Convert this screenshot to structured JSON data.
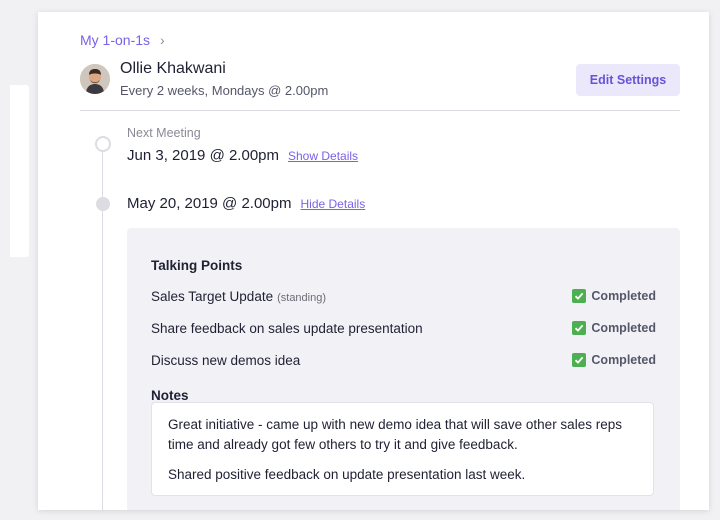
{
  "breadcrumb": {
    "label": "My 1-on-1s",
    "chevron": "›"
  },
  "person": {
    "name": "Ollie Khakwani",
    "schedule": "Every 2 weeks, Mondays @ 2.00pm",
    "avatar_icon": "user-photo"
  },
  "actions": {
    "edit_settings": "Edit Settings"
  },
  "next_meeting": {
    "label": "Next Meeting",
    "date": "Jun 3, 2019 @ 2.00pm",
    "link": "Show Details"
  },
  "past_meeting": {
    "date": "May 20, 2019 @ 2.00pm",
    "link": "Hide Details",
    "talking_points_title": "Talking Points",
    "talking_points": [
      {
        "text": "Sales Target Update",
        "tag": "(standing)",
        "status": "Completed"
      },
      {
        "text": "Share feedback on sales update presentation",
        "tag": "",
        "status": "Completed"
      },
      {
        "text": "Discuss new demos idea",
        "tag": "",
        "status": "Completed"
      }
    ],
    "notes_title": "Notes",
    "notes": [
      "Great initiative - came up with new demo idea that will save other sales reps time and already got few others to try it and give feedback.",
      "Shared positive feedback on update presentation last week."
    ]
  },
  "colors": {
    "accent": "#7b61e8",
    "button_bg": "#ece8fb",
    "check": "#4cb050",
    "details_bg": "#f2f2f6"
  }
}
